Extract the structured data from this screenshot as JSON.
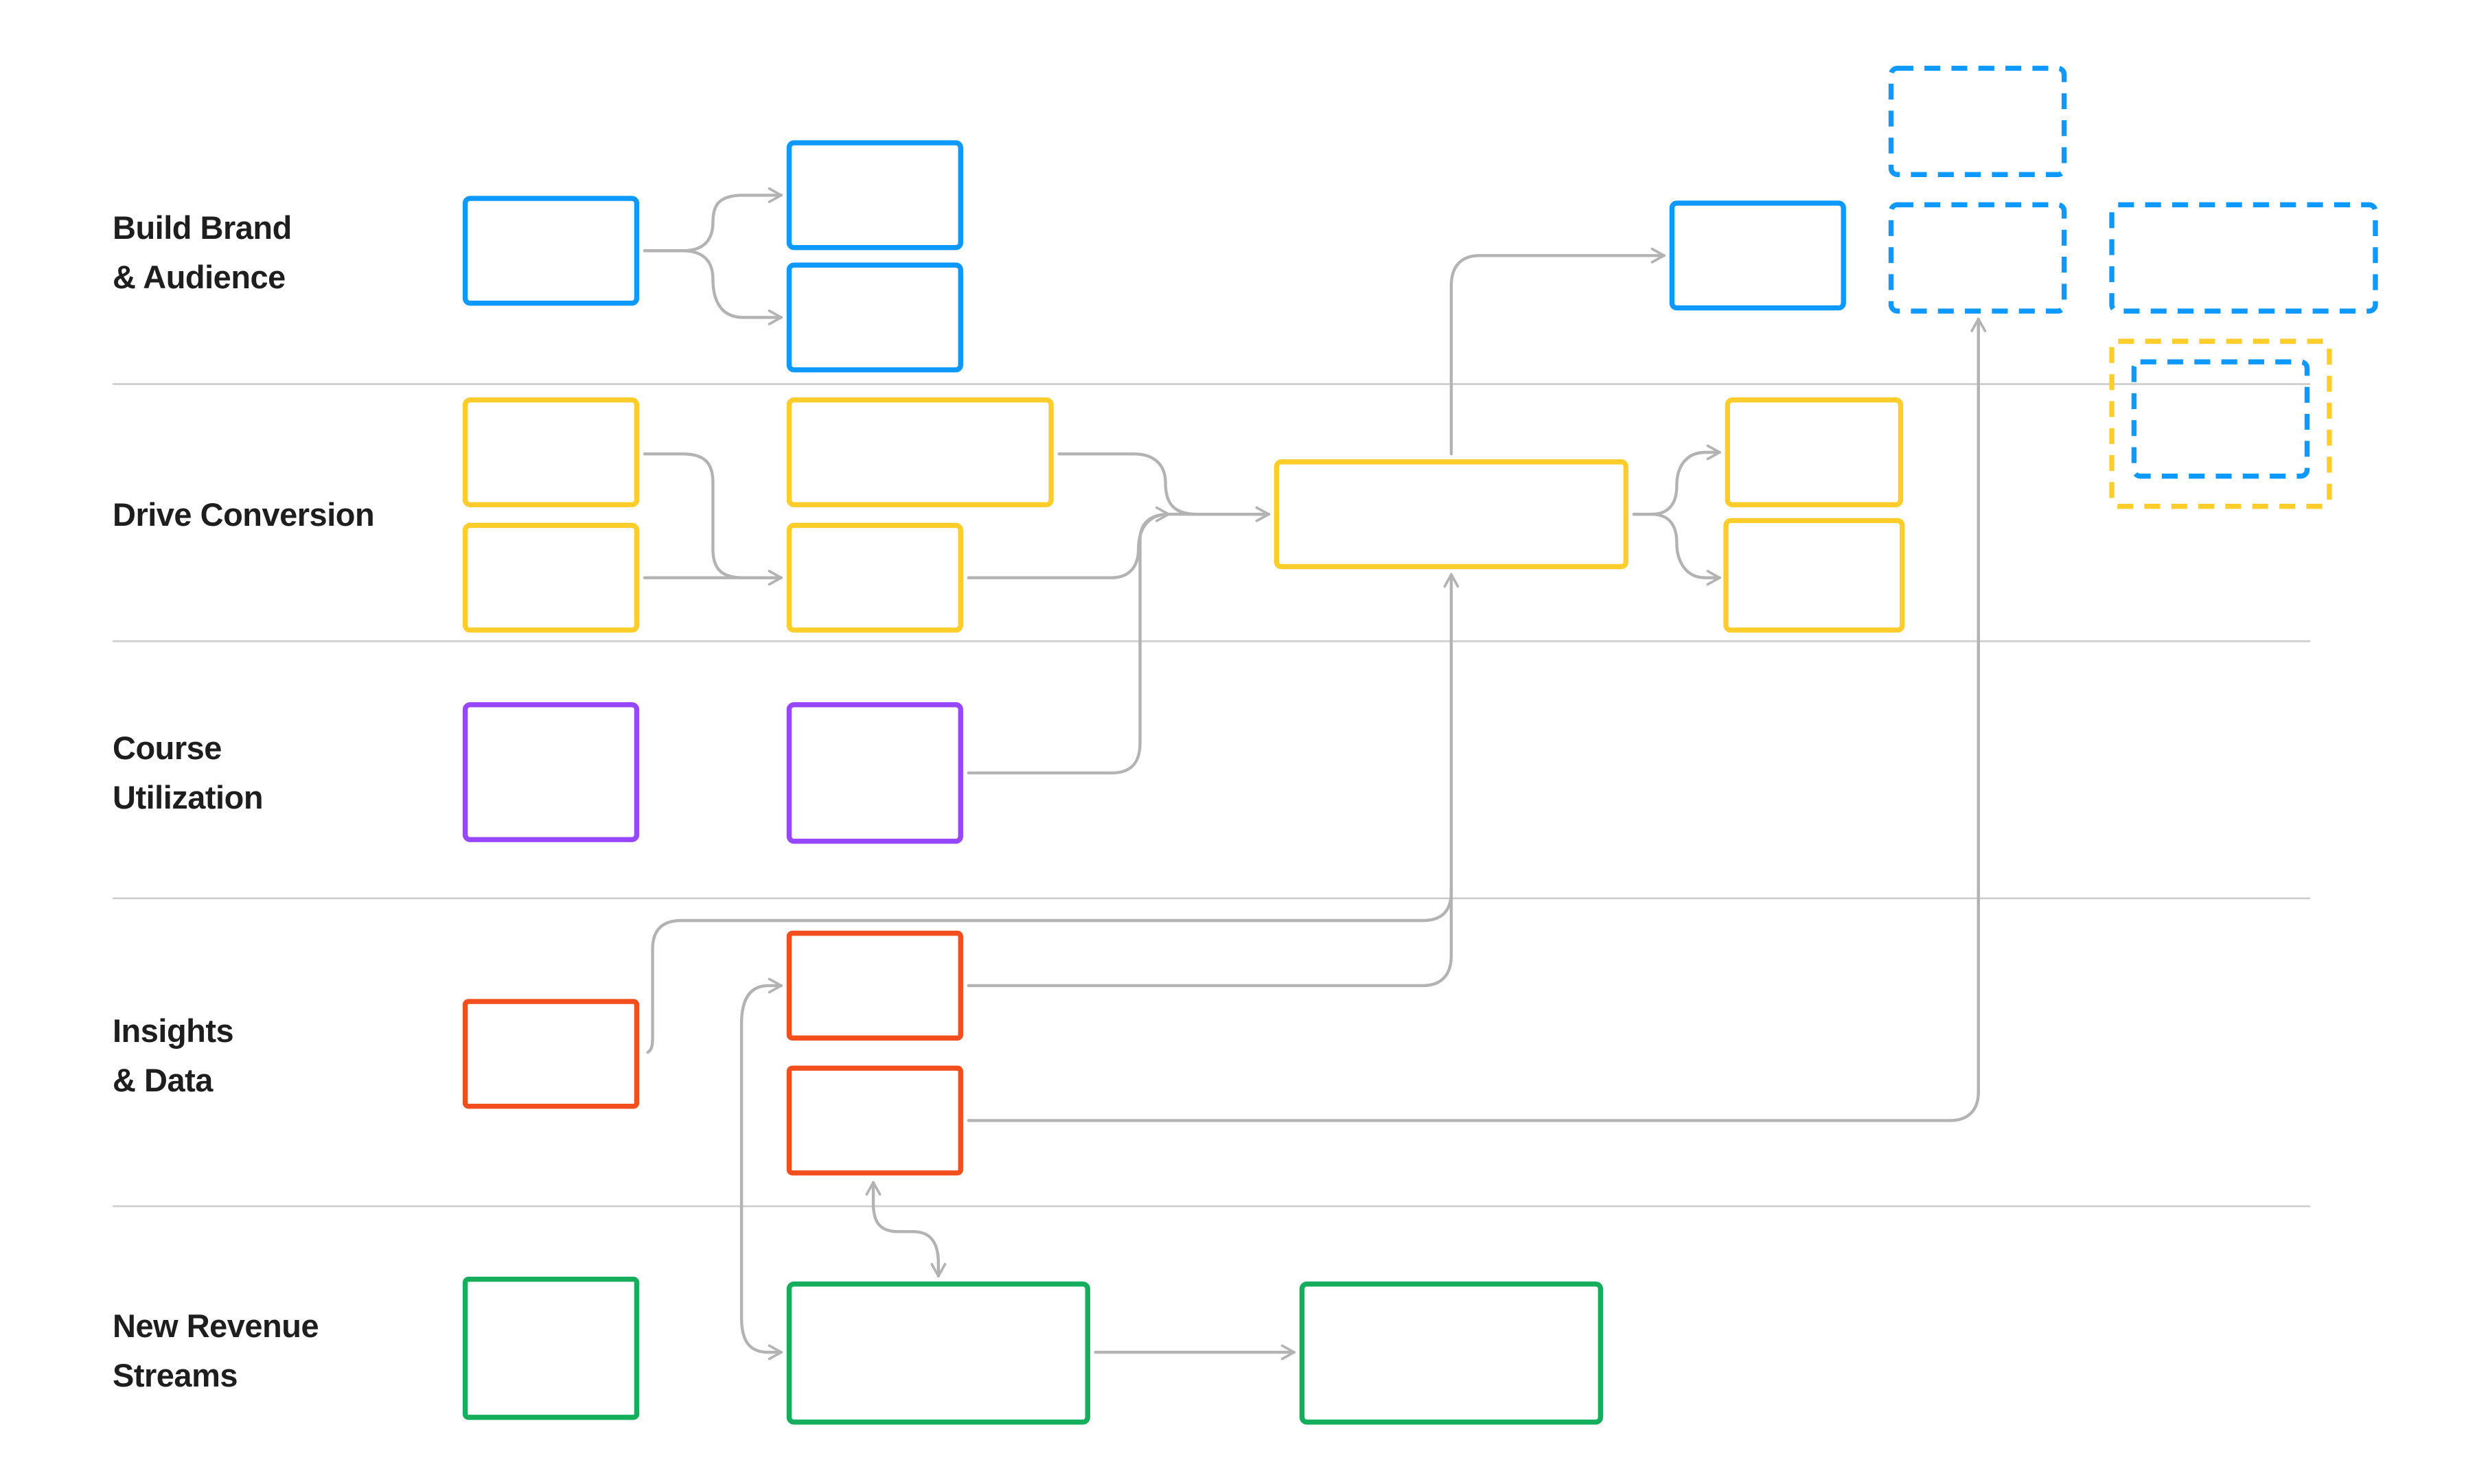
{
  "diagram": {
    "type": "swimlane-flow",
    "colors": {
      "blue": "#0D99FF",
      "yellow": "#FFCD29",
      "purple": "#9747FF",
      "red": "#F24E1E",
      "green": "#14AE5C",
      "connector": "#B3B3B3",
      "divider": "#CCCCCC",
      "text": "#1E1E1E"
    },
    "lanes": [
      {
        "id": "brand",
        "lines": [
          "Build Brand",
          "& Audience"
        ],
        "color": "blue"
      },
      {
        "id": "conversion",
        "lines": [
          "Drive Conversion"
        ],
        "color": "yellow"
      },
      {
        "id": "course",
        "lines": [
          "Course",
          "Utilization"
        ],
        "color": "purple"
      },
      {
        "id": "insights",
        "lines": [
          "Insights",
          "& Data"
        ],
        "color": "red"
      },
      {
        "id": "revenue",
        "lines": [
          "New Revenue",
          "Streams"
        ],
        "color": "green"
      }
    ],
    "nodes": [
      {
        "id": "brand-1",
        "lane": "brand",
        "color": "blue",
        "style": "solid",
        "label": ""
      },
      {
        "id": "brand-2",
        "lane": "brand",
        "color": "blue",
        "style": "solid",
        "label": ""
      },
      {
        "id": "brand-3",
        "lane": "brand",
        "color": "blue",
        "style": "solid",
        "label": ""
      },
      {
        "id": "brand-4",
        "lane": "brand",
        "color": "blue",
        "style": "solid",
        "label": ""
      },
      {
        "id": "brand-future-1",
        "lane": "brand",
        "color": "blue",
        "style": "dashed",
        "label": ""
      },
      {
        "id": "brand-future-2",
        "lane": "brand",
        "color": "blue",
        "style": "dashed",
        "label": ""
      },
      {
        "id": "brand-future-3",
        "lane": "brand",
        "color": "blue",
        "style": "dashed",
        "label": ""
      },
      {
        "id": "shared-future-outer",
        "lane": "conversion",
        "color": "yellow",
        "style": "dashed",
        "label": ""
      },
      {
        "id": "shared-future-inner",
        "lane": "conversion",
        "color": "blue",
        "style": "dashed",
        "label": ""
      },
      {
        "id": "conv-1",
        "lane": "conversion",
        "color": "yellow",
        "style": "solid",
        "label": ""
      },
      {
        "id": "conv-2",
        "lane": "conversion",
        "color": "yellow",
        "style": "solid",
        "label": ""
      },
      {
        "id": "conv-3",
        "lane": "conversion",
        "color": "yellow",
        "style": "solid",
        "label": ""
      },
      {
        "id": "conv-4",
        "lane": "conversion",
        "color": "yellow",
        "style": "solid",
        "label": ""
      },
      {
        "id": "conv-hub",
        "lane": "conversion",
        "color": "yellow",
        "style": "solid",
        "label": ""
      },
      {
        "id": "conv-5",
        "lane": "conversion",
        "color": "yellow",
        "style": "solid",
        "label": ""
      },
      {
        "id": "conv-6",
        "lane": "conversion",
        "color": "yellow",
        "style": "solid",
        "label": ""
      },
      {
        "id": "course-1",
        "lane": "course",
        "color": "purple",
        "style": "solid",
        "label": ""
      },
      {
        "id": "course-2",
        "lane": "course",
        "color": "purple",
        "style": "solid",
        "label": ""
      },
      {
        "id": "insights-1",
        "lane": "insights",
        "color": "red",
        "style": "solid",
        "label": ""
      },
      {
        "id": "insights-2",
        "lane": "insights",
        "color": "red",
        "style": "solid",
        "label": ""
      },
      {
        "id": "insights-3",
        "lane": "insights",
        "color": "red",
        "style": "solid",
        "label": ""
      },
      {
        "id": "revenue-1",
        "lane": "revenue",
        "color": "green",
        "style": "solid",
        "label": ""
      },
      {
        "id": "revenue-2",
        "lane": "revenue",
        "color": "green",
        "style": "solid",
        "label": ""
      },
      {
        "id": "revenue-3",
        "lane": "revenue",
        "color": "green",
        "style": "solid",
        "label": ""
      }
    ],
    "edges": [
      {
        "from": "brand-1",
        "to": "brand-2"
      },
      {
        "from": "brand-1",
        "to": "brand-3"
      },
      {
        "from": "conv-1",
        "to": "conv-4"
      },
      {
        "from": "conv-2",
        "to": "conv-4"
      },
      {
        "from": "conv-3",
        "to": "conv-hub"
      },
      {
        "from": "conv-4",
        "to": "conv-hub"
      },
      {
        "from": "course-2",
        "to": "conv-hub"
      },
      {
        "from": "conv-hub",
        "to": "brand-4"
      },
      {
        "from": "conv-hub",
        "to": "conv-5"
      },
      {
        "from": "conv-hub",
        "to": "conv-6"
      },
      {
        "from": "insights-1",
        "to": "conv-hub"
      },
      {
        "from": "insights-2",
        "to": "conv-hub"
      },
      {
        "from": "insights-3",
        "to": "brand-future-2"
      },
      {
        "from": "insights-2",
        "to": "revenue-2",
        "bidirectional": true
      },
      {
        "from": "insights-3",
        "to": "revenue-2",
        "bidirectional": true
      },
      {
        "from": "revenue-2",
        "to": "revenue-3"
      }
    ]
  }
}
